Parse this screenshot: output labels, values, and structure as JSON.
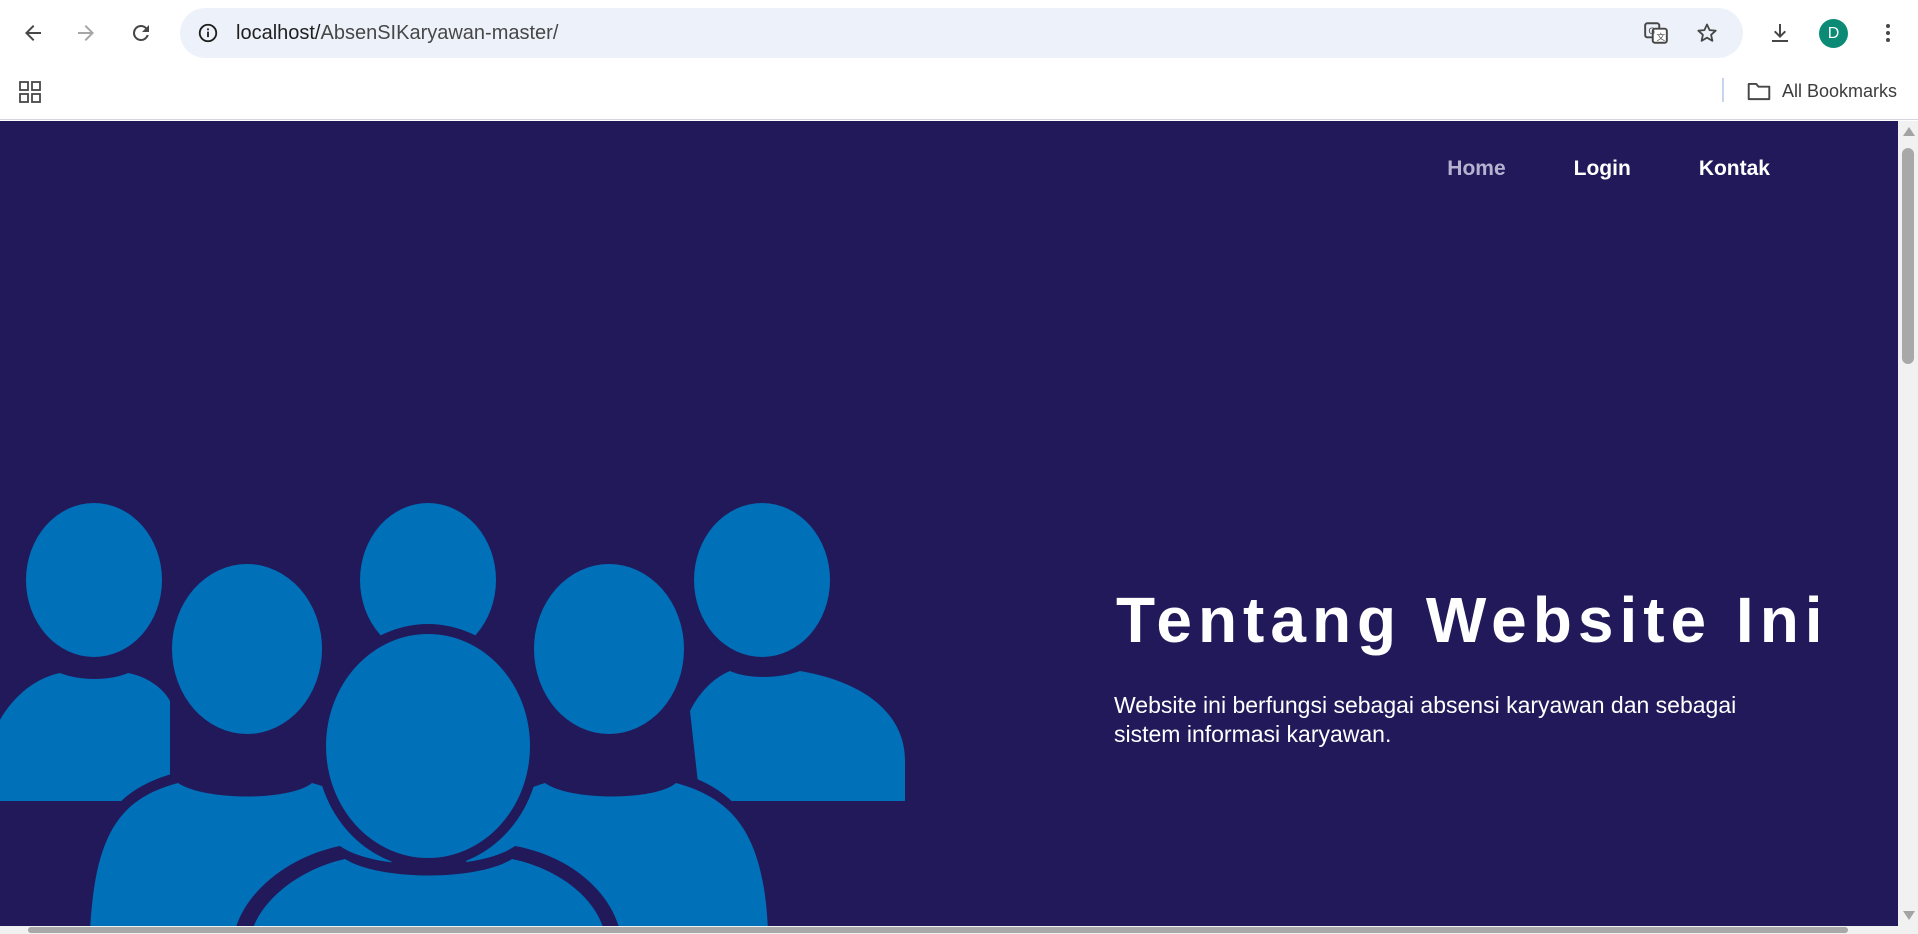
{
  "browser": {
    "url_host": "localhost/",
    "url_path": "AbsenSIKaryawan-master/",
    "profile_initial": "D",
    "icons": {
      "back": "arrow-left-icon",
      "forward": "arrow-right-icon",
      "reload": "reload-icon",
      "site_info": "info-icon",
      "translate": "translate-icon",
      "bookmark": "star-icon",
      "downloads": "download-icon",
      "menu": "kebab-menu-icon",
      "apps": "apps-grid-icon",
      "folder": "folder-icon"
    },
    "bookmarks_bar": {
      "all_bookmarks_label": "All Bookmarks"
    }
  },
  "page": {
    "nav": {
      "items": [
        {
          "label": "Home",
          "active": true
        },
        {
          "label": "Login",
          "active": false
        },
        {
          "label": "Kontak",
          "active": false
        }
      ]
    },
    "hero": {
      "title": "Tentang Website Ini",
      "description": "Website ini berfungsi sebagai absensi karyawan dan sebagai sistem informasi karyawan.",
      "illustration": "group-of-people-icon"
    },
    "colors": {
      "background": "#22195a",
      "illustration": "#0070b8",
      "nav_active": "#b5b2cf",
      "text": "#ffffff"
    }
  }
}
